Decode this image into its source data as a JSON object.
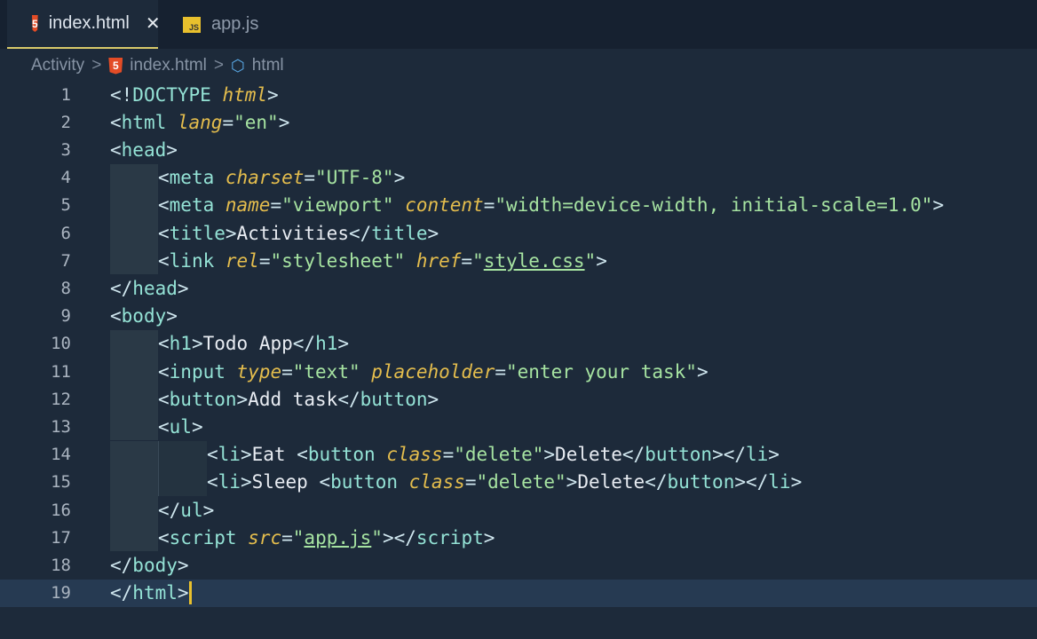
{
  "tabs": [
    {
      "label": "index.html",
      "icon": "html5-icon",
      "active": true
    },
    {
      "label": "app.js",
      "icon": "js-icon",
      "active": false
    }
  ],
  "breadcrumb": [
    "Activity",
    "index.html",
    "html"
  ],
  "icons": {
    "html5": "5",
    "js": "JS",
    "close": "✕",
    "chevron": ">",
    "cube": "⬡"
  },
  "current_line": 19,
  "lines": [
    {
      "n": "1",
      "indent": 0,
      "tokens": [
        [
          "p",
          "<!"
        ],
        [
          "t",
          "DOCTYPE "
        ],
        [
          "a",
          "html"
        ],
        [
          "p",
          ">"
        ]
      ]
    },
    {
      "n": "2",
      "indent": 0,
      "tokens": [
        [
          "p",
          "<"
        ],
        [
          "t",
          "html "
        ],
        [
          "a",
          "lang"
        ],
        [
          "p",
          "="
        ],
        [
          "s",
          "\"en\""
        ],
        [
          "p",
          ">"
        ]
      ]
    },
    {
      "n": "3",
      "indent": 0,
      "tokens": [
        [
          "p",
          "<"
        ],
        [
          "t",
          "head"
        ],
        [
          "p",
          ">"
        ]
      ]
    },
    {
      "n": "4",
      "indent": 1,
      "tokens": [
        [
          "p",
          "<"
        ],
        [
          "t",
          "meta "
        ],
        [
          "a",
          "charset"
        ],
        [
          "p",
          "="
        ],
        [
          "s",
          "\"UTF-8\""
        ],
        [
          "p",
          ">"
        ]
      ]
    },
    {
      "n": "5",
      "indent": 1,
      "tokens": [
        [
          "p",
          "<"
        ],
        [
          "t",
          "meta "
        ],
        [
          "a",
          "name"
        ],
        [
          "p",
          "="
        ],
        [
          "s",
          "\"viewport\" "
        ],
        [
          "a",
          "content"
        ],
        [
          "p",
          "="
        ],
        [
          "s",
          "\"width=device-width, initial-scale=1.0\""
        ],
        [
          "p",
          ">"
        ]
      ]
    },
    {
      "n": "6",
      "indent": 1,
      "tokens": [
        [
          "p",
          "<"
        ],
        [
          "t",
          "title"
        ],
        [
          "p",
          ">"
        ],
        [
          "x",
          "Activities"
        ],
        [
          "p",
          "</"
        ],
        [
          "t",
          "title"
        ],
        [
          "p",
          ">"
        ]
      ]
    },
    {
      "n": "7",
      "indent": 1,
      "tokens": [
        [
          "p",
          "<"
        ],
        [
          "t",
          "link "
        ],
        [
          "a",
          "rel"
        ],
        [
          "p",
          "="
        ],
        [
          "s",
          "\"stylesheet\" "
        ],
        [
          "a",
          "href"
        ],
        [
          "p",
          "="
        ],
        [
          "s",
          "\""
        ],
        [
          "u",
          "style.css"
        ],
        [
          "s",
          "\""
        ],
        [
          "p",
          ">"
        ]
      ]
    },
    {
      "n": "8",
      "indent": 0,
      "tokens": [
        [
          "p",
          "</"
        ],
        [
          "t",
          "head"
        ],
        [
          "p",
          ">"
        ]
      ]
    },
    {
      "n": "9",
      "indent": 0,
      "tokens": [
        [
          "p",
          "<"
        ],
        [
          "t",
          "body"
        ],
        [
          "p",
          ">"
        ]
      ]
    },
    {
      "n": "10",
      "indent": 1,
      "tokens": [
        [
          "p",
          "<"
        ],
        [
          "t",
          "h1"
        ],
        [
          "p",
          ">"
        ],
        [
          "x",
          "Todo App"
        ],
        [
          "p",
          "</"
        ],
        [
          "t",
          "h1"
        ],
        [
          "p",
          ">"
        ]
      ]
    },
    {
      "n": "11",
      "indent": 1,
      "tokens": [
        [
          "p",
          "<"
        ],
        [
          "t",
          "input "
        ],
        [
          "a",
          "type"
        ],
        [
          "p",
          "="
        ],
        [
          "s",
          "\"text\" "
        ],
        [
          "a",
          "placeholder"
        ],
        [
          "p",
          "="
        ],
        [
          "s",
          "\"enter your task\""
        ],
        [
          "p",
          ">"
        ]
      ]
    },
    {
      "n": "12",
      "indent": 1,
      "tokens": [
        [
          "p",
          "<"
        ],
        [
          "t",
          "button"
        ],
        [
          "p",
          ">"
        ],
        [
          "x",
          "Add task"
        ],
        [
          "p",
          "</"
        ],
        [
          "t",
          "button"
        ],
        [
          "p",
          ">"
        ]
      ]
    },
    {
      "n": "13",
      "indent": 1,
      "tokens": [
        [
          "p",
          "<"
        ],
        [
          "t",
          "ul"
        ],
        [
          "p",
          ">"
        ]
      ]
    },
    {
      "n": "14",
      "indent": 2,
      "tokens": [
        [
          "p",
          "<"
        ],
        [
          "t",
          "li"
        ],
        [
          "p",
          ">"
        ],
        [
          "x",
          "Eat "
        ],
        [
          "p",
          "<"
        ],
        [
          "t",
          "button "
        ],
        [
          "a",
          "class"
        ],
        [
          "p",
          "="
        ],
        [
          "s",
          "\"delete\""
        ],
        [
          "p",
          ">"
        ],
        [
          "x",
          "Delete"
        ],
        [
          "p",
          "</"
        ],
        [
          "t",
          "button"
        ],
        [
          "p",
          "></"
        ],
        [
          "t",
          "li"
        ],
        [
          "p",
          ">"
        ]
      ]
    },
    {
      "n": "15",
      "indent": 2,
      "tokens": [
        [
          "p",
          "<"
        ],
        [
          "t",
          "li"
        ],
        [
          "p",
          ">"
        ],
        [
          "x",
          "Sleep "
        ],
        [
          "p",
          "<"
        ],
        [
          "t",
          "button "
        ],
        [
          "a",
          "class"
        ],
        [
          "p",
          "="
        ],
        [
          "s",
          "\"delete\""
        ],
        [
          "p",
          ">"
        ],
        [
          "x",
          "Delete"
        ],
        [
          "p",
          "</"
        ],
        [
          "t",
          "button"
        ],
        [
          "p",
          "></"
        ],
        [
          "t",
          "li"
        ],
        [
          "p",
          ">"
        ]
      ]
    },
    {
      "n": "16",
      "indent": 1,
      "tokens": [
        [
          "p",
          "</"
        ],
        [
          "t",
          "ul"
        ],
        [
          "p",
          ">"
        ]
      ]
    },
    {
      "n": "17",
      "indent": 1,
      "tokens": [
        [
          "p",
          "<"
        ],
        [
          "t",
          "script "
        ],
        [
          "a",
          "src"
        ],
        [
          "p",
          "="
        ],
        [
          "s",
          "\""
        ],
        [
          "u",
          "app.js"
        ],
        [
          "s",
          "\""
        ],
        [
          "p",
          "></"
        ],
        [
          "t",
          "script"
        ],
        [
          "p",
          ">"
        ]
      ]
    },
    {
      "n": "18",
      "indent": 0,
      "tokens": [
        [
          "p",
          "</"
        ],
        [
          "t",
          "body"
        ],
        [
          "p",
          ">"
        ]
      ]
    },
    {
      "n": "19",
      "indent": 0,
      "tokens": [
        [
          "p",
          "</"
        ],
        [
          "t",
          "html"
        ],
        [
          "p",
          ">"
        ]
      ]
    }
  ]
}
